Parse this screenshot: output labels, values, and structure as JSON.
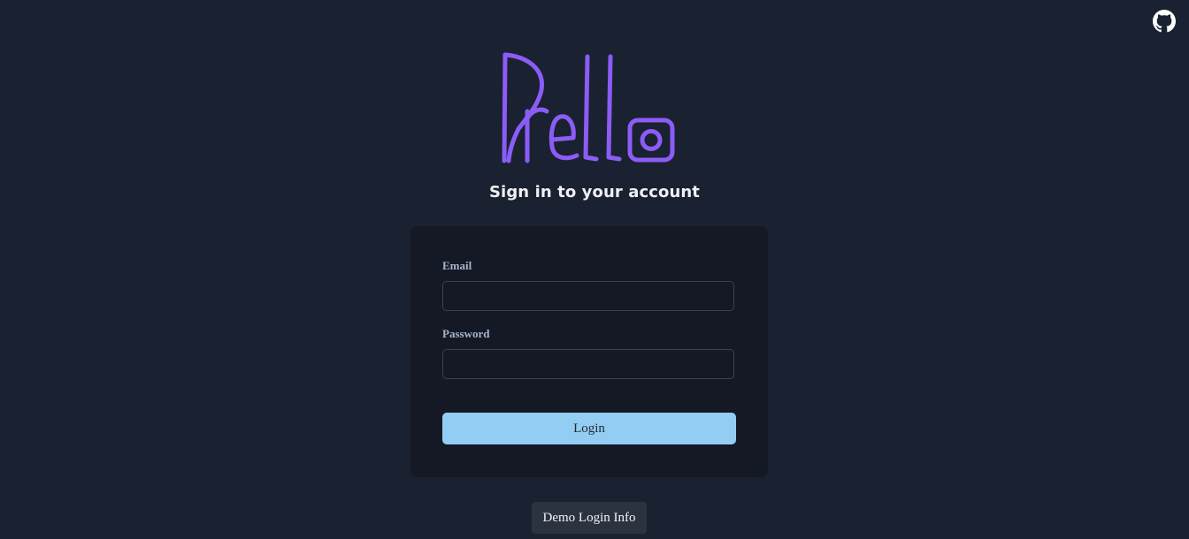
{
  "header": {
    "github_icon": "github-icon"
  },
  "brand": {
    "logo_text": "Prello",
    "logo_color": "#8b5cf6"
  },
  "page": {
    "title": "Sign in to your account"
  },
  "form": {
    "email_label": "Email",
    "email_value": "",
    "password_label": "Password",
    "password_value": "",
    "login_label": "Login"
  },
  "footer": {
    "demo_label": "Demo Login Info"
  },
  "colors": {
    "background": "#1a2130",
    "card": "#141925",
    "primary_button": "#93cdf4",
    "secondary_button": "#2c3340",
    "accent": "#8b5cf6"
  }
}
